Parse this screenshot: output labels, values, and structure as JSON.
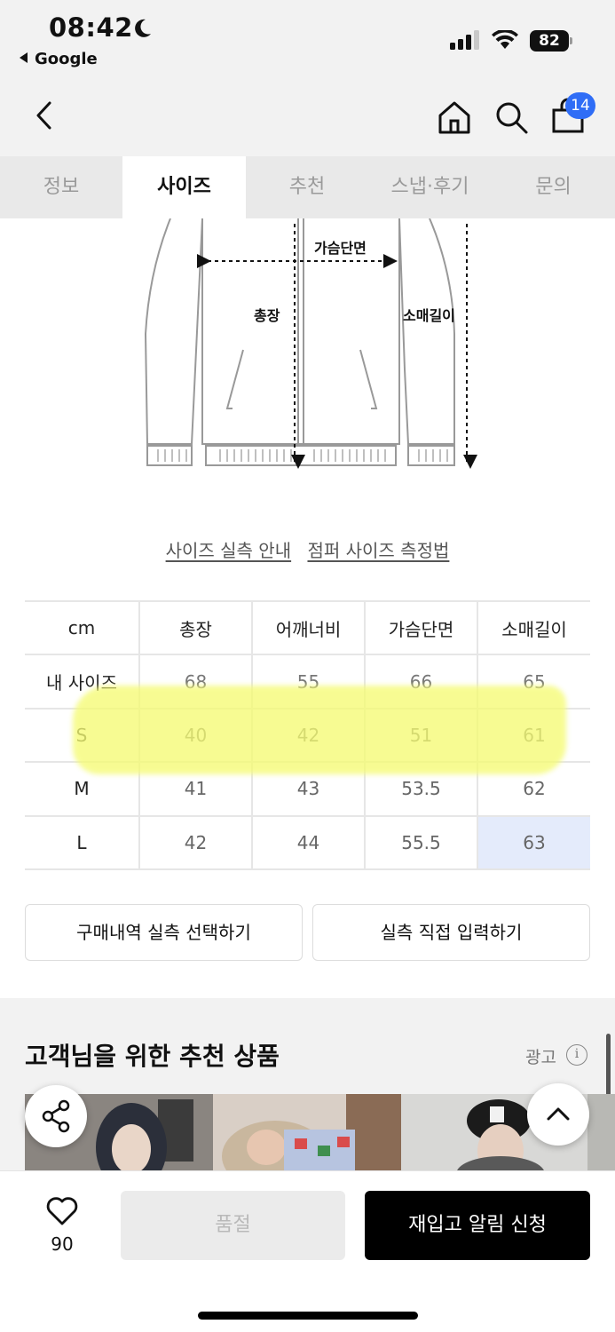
{
  "status_bar": {
    "time": "08:42",
    "back_app": "Google",
    "battery": "82",
    "icons": [
      "moon-icon",
      "signal-icon",
      "wifi-icon",
      "battery-icon"
    ]
  },
  "header": {
    "icons": [
      "back-arrow-icon",
      "home-icon",
      "search-icon",
      "shopping-bag-icon"
    ],
    "cart_count": "14"
  },
  "tabs": [
    {
      "label": "정보",
      "active": false
    },
    {
      "label": "사이즈",
      "active": true
    },
    {
      "label": "추천",
      "active": false
    },
    {
      "label": "스냅·후기",
      "active": false
    },
    {
      "label": "문의",
      "active": false
    }
  ],
  "diagram": {
    "chest": "가슴단면",
    "length": "총장",
    "sleeve": "소매길이"
  },
  "guide_links": {
    "size_guide": "사이즈 실측 안내",
    "jumper_method": "점퍼 사이즈 측정법"
  },
  "size_table": {
    "headers": [
      "cm",
      "총장",
      "어깨너비",
      "가슴단면",
      "소매길이"
    ],
    "rows": [
      [
        "내 사이즈",
        "68",
        "55",
        "66",
        "65"
      ],
      [
        "S",
        "40",
        "42",
        "51",
        "61"
      ],
      [
        "M",
        "41",
        "43",
        "53.5",
        "62"
      ],
      [
        "L",
        "42",
        "44",
        "55.5",
        "63"
      ]
    ]
  },
  "actions": {
    "purchase_history": "구매내역 실측 선택하기",
    "direct_input": "실측 직접 입력하기"
  },
  "recommendation": {
    "title": "고객님을 위한 추천 상품",
    "ad_label": "광고",
    "info_icon": "i"
  },
  "bottom_bar": {
    "like_count": "90",
    "soldout": "품절",
    "restock": "재입고 알림 신청"
  },
  "colors": {
    "accent": "#2f6df6",
    "highlight": "#f5fb74",
    "cell_highlight": "#e4ebfb"
  }
}
